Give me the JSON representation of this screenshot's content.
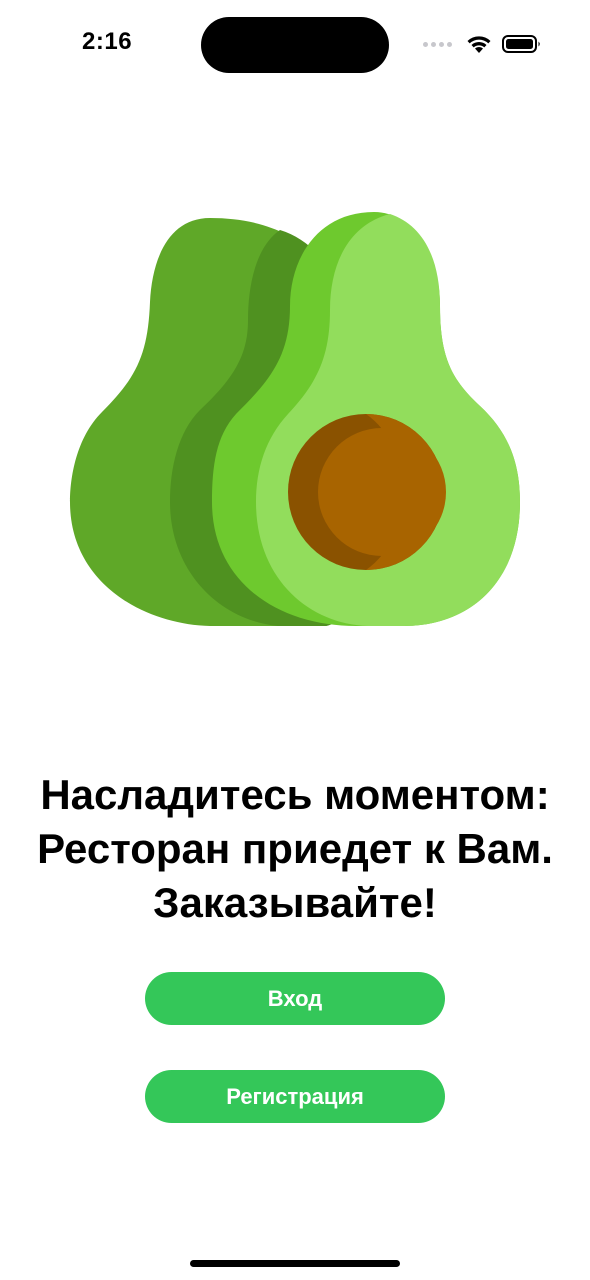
{
  "status_bar": {
    "time": "2:16"
  },
  "hero": {
    "icon": "avocado-illustration"
  },
  "headline": {
    "line1": "Насладитесь моментом:",
    "line2": "Ресторан приедет к Вам.",
    "line3": "Заказывайте!"
  },
  "actions": {
    "login_label": "Вход",
    "register_label": "Регистрация"
  },
  "colors": {
    "accent": "#34c759",
    "avocado_dark": "#5fa828",
    "avocado_mid": "#6ec92e",
    "avocado_light": "#92dd5c",
    "pit": "#a86400"
  }
}
